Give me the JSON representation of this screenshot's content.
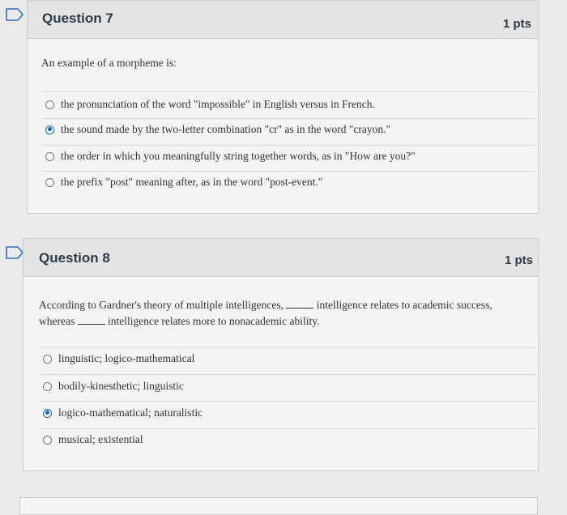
{
  "questions": [
    {
      "title": "Question 7",
      "points": "1 pts",
      "text": "An example of a morpheme is:",
      "answers": [
        {
          "label": "the pronunciation of the word \"impossible\" in English versus in French.",
          "selected": false
        },
        {
          "label": "the sound made by the two-letter combination \"cr\" as in the word \"crayon.\"",
          "selected": true
        },
        {
          "label": "the order in which you meaningfully string together words, as in \"How are you?\"",
          "selected": false
        },
        {
          "label": "the prefix \"post\" meaning after, as in the word \"post-event.\"",
          "selected": false
        }
      ]
    },
    {
      "title": "Question 8",
      "points": "1 pts",
      "text_part1": "According to Gardner's theory of multiple intelligences,",
      "text_part2": "intelligence relates to academic success,",
      "text_part3": "whereas",
      "text_part4": "intelligence relates more to nonacademic ability.",
      "answers": [
        {
          "label": "linguistic; logico-mathematical",
          "selected": false
        },
        {
          "label": "bodily-kinesthetic; linguistic",
          "selected": false
        },
        {
          "label": "logico-mathematical; naturalistic",
          "selected": true
        },
        {
          "label": "musical; existential",
          "selected": false
        }
      ]
    }
  ],
  "colors": {
    "flag": "#2d6fc5",
    "selected_radio": "#0e68c0",
    "header_bg": "#e3e4e6",
    "body_bg": "#f5f4f2"
  },
  "icons": {
    "flag": "flag-question-icon"
  }
}
